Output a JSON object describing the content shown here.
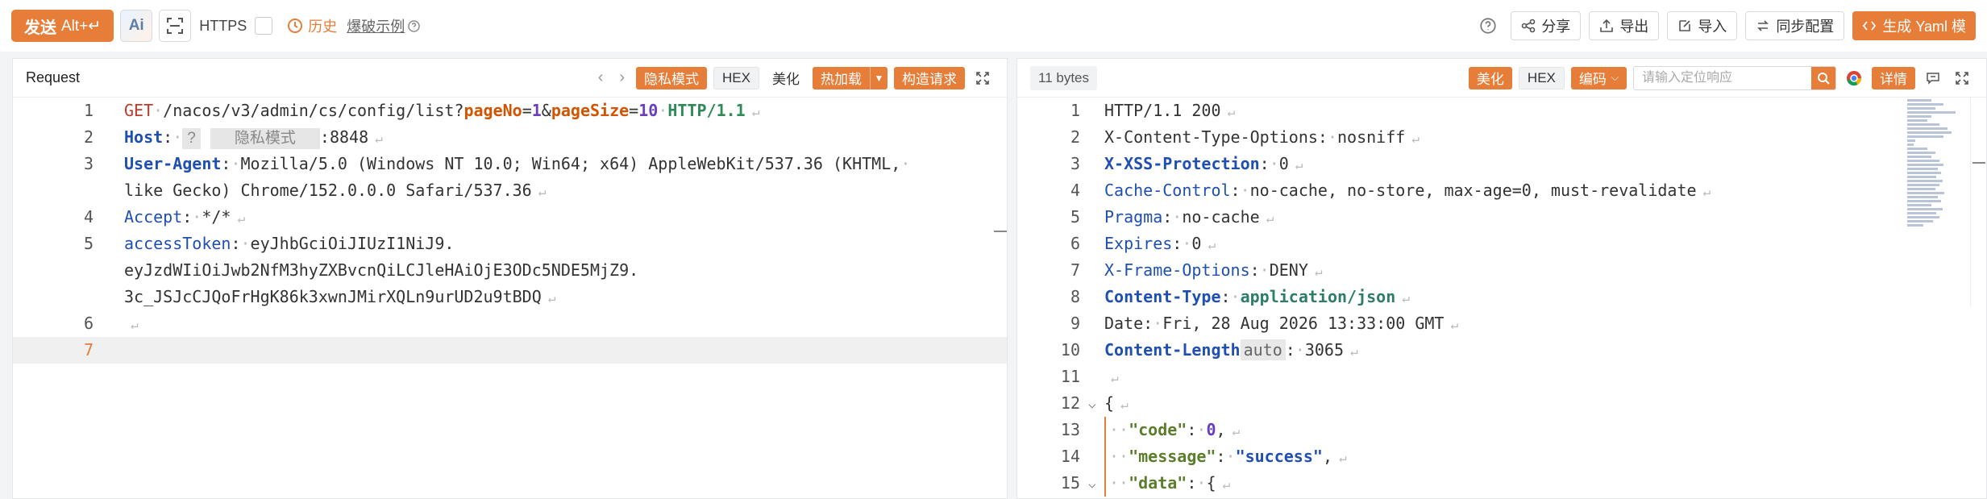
{
  "toolbar": {
    "send_label": "发送",
    "send_shortcut": "Alt+↵",
    "ai_label": "Ai",
    "https_label": "HTTPS",
    "history_label": "历史",
    "example_label": "爆破示例",
    "share_label": "分享",
    "export_label": "导出",
    "import_label": "导入",
    "sync_label": "同步配置",
    "yaml_label": "生成 Yaml 模"
  },
  "request": {
    "title": "Request",
    "privacy_label": "隐私模式",
    "hex_label": "HEX",
    "beautify_label": "美化",
    "hotload_label": "热加载",
    "construct_label": "构造请求",
    "line_numbers": [
      "1",
      "2",
      "3",
      "",
      "4",
      "5",
      "",
      "",
      "6",
      "7"
    ],
    "l1_method": "GET",
    "l1_path": "/nacos/v3/admin/cs/config/list?",
    "l1_p1": "pageNo",
    "l1_eq1": "=",
    "l1_v1": "1",
    "l1_amp": "&",
    "l1_p2": "pageSize",
    "l1_eq2": "=",
    "l1_v2": "10",
    "l1_proto": "HTTP/1.1",
    "l2_key": "Host",
    "l2_q": "?",
    "l2_mask": "隐私模式",
    "l2_port": ":8848",
    "l3_key": "User-Agent",
    "l3_val": "Mozilla/5.0 (Windows NT 10.0; Win64; x64) AppleWebKit/537.36 (KHTML,",
    "l3b_val": "like Gecko) Chrome/152.0.0.0 Safari/537.36",
    "l4_key": "Accept",
    "l4_val": "*/*",
    "l5_key": "accessToken",
    "l5_val": "eyJhbGciOiJIUzI1NiJ9.",
    "l5b_val": "eyJzdWIiOiJwb2NfM3hyZXBvcnQiLCJleHAiOjE3ODc5NDE5MjZ9.",
    "l5c_val": "3c_JSJcCJQoFrHgK86k3xwnJMirXQLn9urUD2u9tBDQ"
  },
  "response": {
    "bytes_label": "11 bytes",
    "beautify_label": "美化",
    "hex_label": "HEX",
    "encode_label": "编码",
    "search_placeholder": "请输入定位响应",
    "detail_label": "详情",
    "line_numbers": [
      "1",
      "2",
      "3",
      "4",
      "5",
      "6",
      "7",
      "8",
      "9",
      "10",
      "11",
      "12",
      "13",
      "14",
      "15"
    ],
    "r1": "HTTP/1.1 200",
    "r2_key": "X-Content-Type-Options",
    "r2_val": "nosniff",
    "r3_key": "X-XSS-Protection",
    "r3_val": "0",
    "r4_key": "Cache-Control",
    "r4_val": "no-cache, no-store, max-age=0, must-revalidate",
    "r5_key": "Pragma",
    "r5_val": "no-cache",
    "r6_key": "Expires",
    "r6_val": "0",
    "r7_key": "X-Frame-Options",
    "r7_val": "DENY",
    "r8_key": "Content-Type",
    "r8_val": "application/json",
    "r9_key": "Date",
    "r9_val": "Fri, 28 Aug 2026 13:33:00 GMT",
    "r10_key": "Content-Length",
    "r10_tag": "auto",
    "r10_val": "3065",
    "r12": "{",
    "r13_key": "\"code\"",
    "r13_val": "0",
    "r14_key": "\"message\"",
    "r14_val": "\"success\"",
    "r15_key": "\"data\"",
    "r15_val": "{"
  },
  "colors": {
    "accent": "#e67e3a"
  }
}
